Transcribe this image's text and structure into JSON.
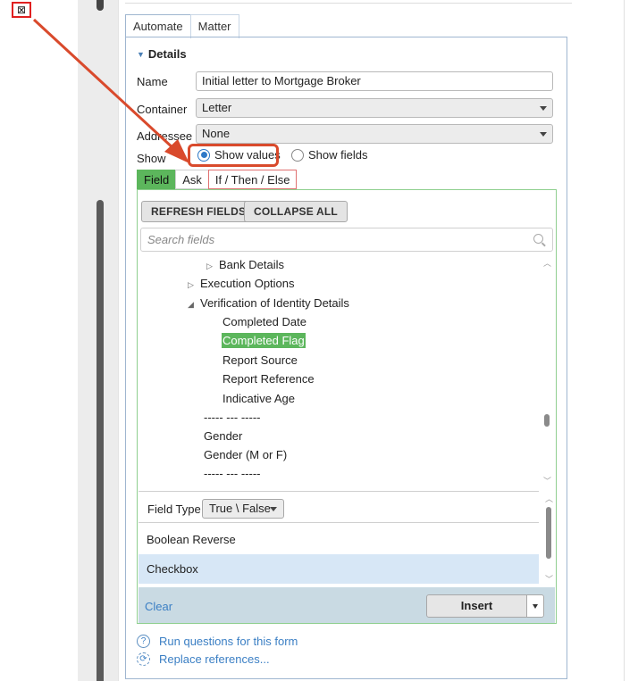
{
  "tabs": [
    "Automate",
    "Matter"
  ],
  "details": {
    "heading": "Details",
    "name_label": "Name",
    "name_value": "Initial letter to Mortgage Broker",
    "container_label": "Container",
    "container_value": "Letter",
    "addressee_label": "Addressee",
    "addressee_value": "None",
    "show_label": "Show",
    "show_values": "Show values",
    "show_fields": "Show fields"
  },
  "subtabs": [
    "Field",
    "Ask",
    "If / Then / Else"
  ],
  "buttons": {
    "refresh": "REFRESH FIELDS",
    "collapse": "COLLAPSE ALL"
  },
  "search": {
    "placeholder": "Search fields"
  },
  "tree": [
    {
      "label": "Bank Details",
      "expander": "▷"
    },
    {
      "label": "Execution Options",
      "expander": "▷"
    },
    {
      "label": "Verification of Identity Details",
      "expander": "◢"
    },
    {
      "label": "Completed Date"
    },
    {
      "label": "Completed Flag",
      "selected": true
    },
    {
      "label": "Report Source"
    },
    {
      "label": "Report Reference"
    },
    {
      "label": "Indicative Age"
    },
    {
      "label": "----- --- -----"
    },
    {
      "label": "Gender"
    },
    {
      "label": "Gender (M or F)"
    },
    {
      "label": "----- --- -----"
    }
  ],
  "field_type": {
    "label": "Field Type",
    "value": "True \\ False"
  },
  "options": [
    {
      "label": "Boolean Reverse"
    },
    {
      "label": "Checkbox",
      "selected": true
    }
  ],
  "actions": {
    "clear": "Clear",
    "insert": "Insert"
  },
  "links": {
    "run_questions": "Run questions for this form",
    "replace_refs": "Replace references..."
  },
  "colors": {
    "accent_green": "#5cb65c",
    "highlight_red": "#d94a2c",
    "link_blue": "#3b7fc4"
  }
}
